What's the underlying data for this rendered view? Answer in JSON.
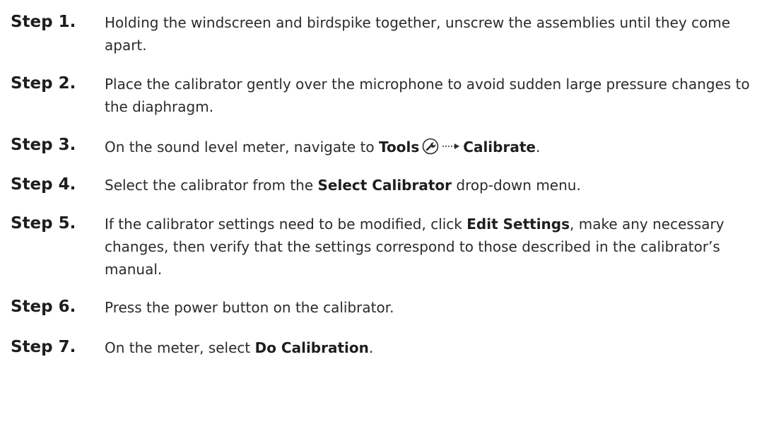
{
  "steps": [
    {
      "label": "Step 1.",
      "text": "Holding the windscreen and birdspike together, unscrew the assemblies until they come apart."
    },
    {
      "label": "Step 2.",
      "text": "Place the calibrator gently over the microphone to avoid sudden large pressure changes to the diaphragm."
    },
    {
      "label": "Step 3.",
      "pre": "On the sound level meter, navigate to ",
      "bold1": "Tools",
      "icon": "wrench-icon",
      "arrow_icon": "dotted-arrow-icon",
      "bold2": "Calibrate",
      "post": "."
    },
    {
      "label": "Step 4.",
      "pre": "Select the calibrator from the ",
      "bold": "Select Calibrator",
      "post": " drop-down menu."
    },
    {
      "label": "Step 5.",
      "pre": "If the calibrator settings need to be modified, click ",
      "bold": "Edit Settings",
      "post": ", make any necessary changes, then verify that the settings correspond to those described in the calibrator’s manual."
    },
    {
      "label": "Step 6.",
      "text": "Press the power button on the calibrator."
    },
    {
      "label": "Step 7.",
      "pre": "On the meter, select ",
      "bold": "Do Calibration",
      "post": "."
    }
  ]
}
